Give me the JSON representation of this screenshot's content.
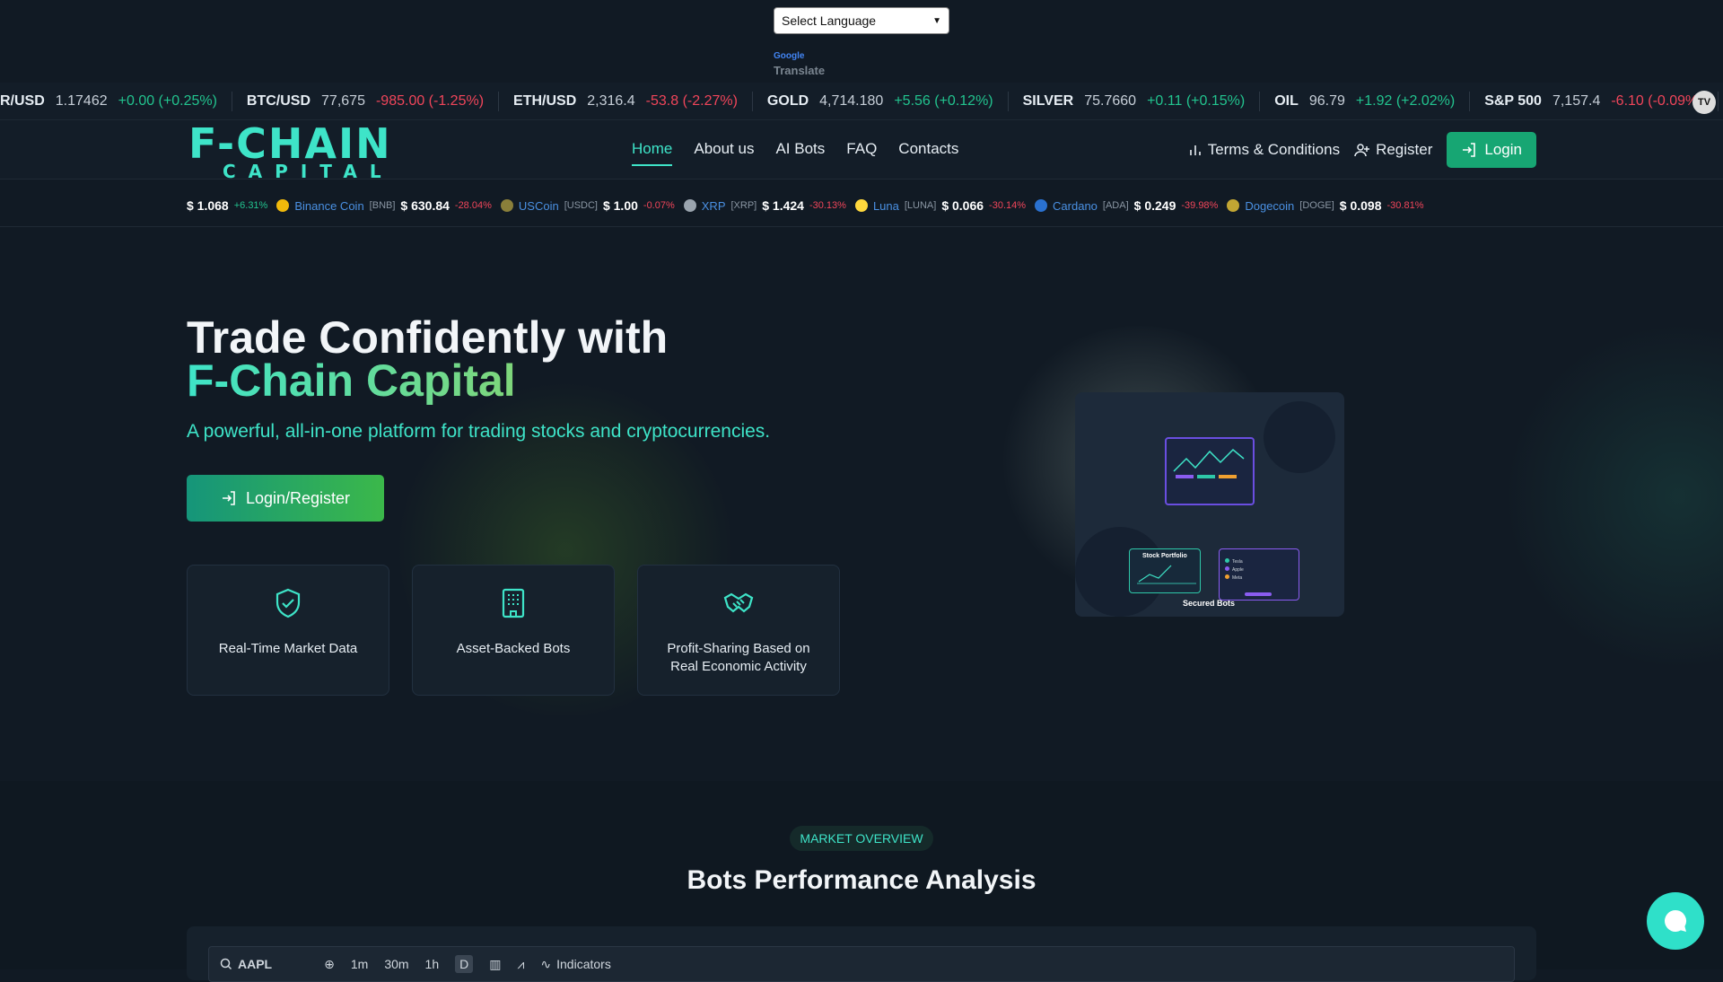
{
  "language": {
    "select_label": "Select Language",
    "google": "Google",
    "translate": "Translate"
  },
  "ticker": [
    {
      "sym": "R/USD",
      "price": "1.17462",
      "chg": "+0.00 (+0.25%)",
      "dir": "pos"
    },
    {
      "sym": "BTC/USD",
      "price": "77,675",
      "chg": "-985.00 (-1.25%)",
      "dir": "neg"
    },
    {
      "sym": "ETH/USD",
      "price": "2,316.4",
      "chg": "-53.8 (-2.27%)",
      "dir": "neg"
    },
    {
      "sym": "GOLD",
      "price": "4,714.180",
      "chg": "+5.56 (+0.12%)",
      "dir": "pos"
    },
    {
      "sym": "SILVER",
      "price": "75.7660",
      "chg": "+0.11 (+0.15%)",
      "dir": "pos"
    },
    {
      "sym": "OIL",
      "price": "96.79",
      "chg": "+1.92 (+2.02%)",
      "dir": "pos"
    },
    {
      "sym": "S&P 500",
      "price": "7,157.4",
      "chg": "-6.10 (-0.09%)",
      "dir": "neg"
    }
  ],
  "tv_logo": "TV",
  "brand": {
    "top": "F-CHAIN",
    "bottom": "CAPITAL"
  },
  "nav": [
    {
      "label": "Home",
      "active": true
    },
    {
      "label": "About us"
    },
    {
      "label": "AI Bots"
    },
    {
      "label": "FAQ"
    },
    {
      "label": "Contacts"
    }
  ],
  "header_right": {
    "terms": "Terms & Conditions",
    "register": "Register",
    "login": "Login"
  },
  "crypto": {
    "lead_price": "$ 1.068",
    "lead_chg": "+6.31%",
    "items": [
      {
        "name": "Binance Coin",
        "sym": "[BNB]",
        "price": "$ 630.84",
        "chg": "-28.04%",
        "color": "#f0b90b"
      },
      {
        "name": "USCoin",
        "sym": "[USDC]",
        "price": "$ 1.00",
        "chg": "-0.07%",
        "color": "#8a7f3a"
      },
      {
        "name": "XRP",
        "sym": "[XRP]",
        "price": "$ 1.424",
        "chg": "-30.13%",
        "color": "#9aa4ae"
      },
      {
        "name": "Luna",
        "sym": "[LUNA]",
        "price": "$ 0.066",
        "chg": "-30.14%",
        "color": "#ffd83d"
      },
      {
        "name": "Cardano",
        "sym": "[ADA]",
        "price": "$ 0.249",
        "chg": "-39.98%",
        "color": "#2a71d0"
      },
      {
        "name": "Dogecoin",
        "sym": "[DOGE]",
        "price": "$ 0.098",
        "chg": "-30.81%",
        "color": "#c2a633"
      }
    ]
  },
  "hero": {
    "title_line1": "Trade Confidently with",
    "title_line2": "F-Chain Capital",
    "subtitle": "A powerful, all-in-one platform for trading stocks and cryptocurrencies.",
    "cta": "Login/Register",
    "features": [
      {
        "label": "Real-Time Market Data",
        "icon": "shield-check-icon"
      },
      {
        "label": "Asset-Backed Bots",
        "icon": "building-icon"
      },
      {
        "label": "Profit-Sharing Based on Real Economic Activity",
        "icon": "handshake-icon"
      }
    ],
    "illus": {
      "stock": "Stock Portfolio",
      "secured": "Secured Bots",
      "rows": [
        "Tesla",
        "Apple",
        "Meta"
      ]
    }
  },
  "market": {
    "pill": "MARKET OVERVIEW",
    "title": "Bots Performance Analysis",
    "toolbar": {
      "symbol": "AAPL",
      "intervals": [
        "1m",
        "30m",
        "1h",
        "D"
      ],
      "indicators": "Indicators"
    }
  }
}
